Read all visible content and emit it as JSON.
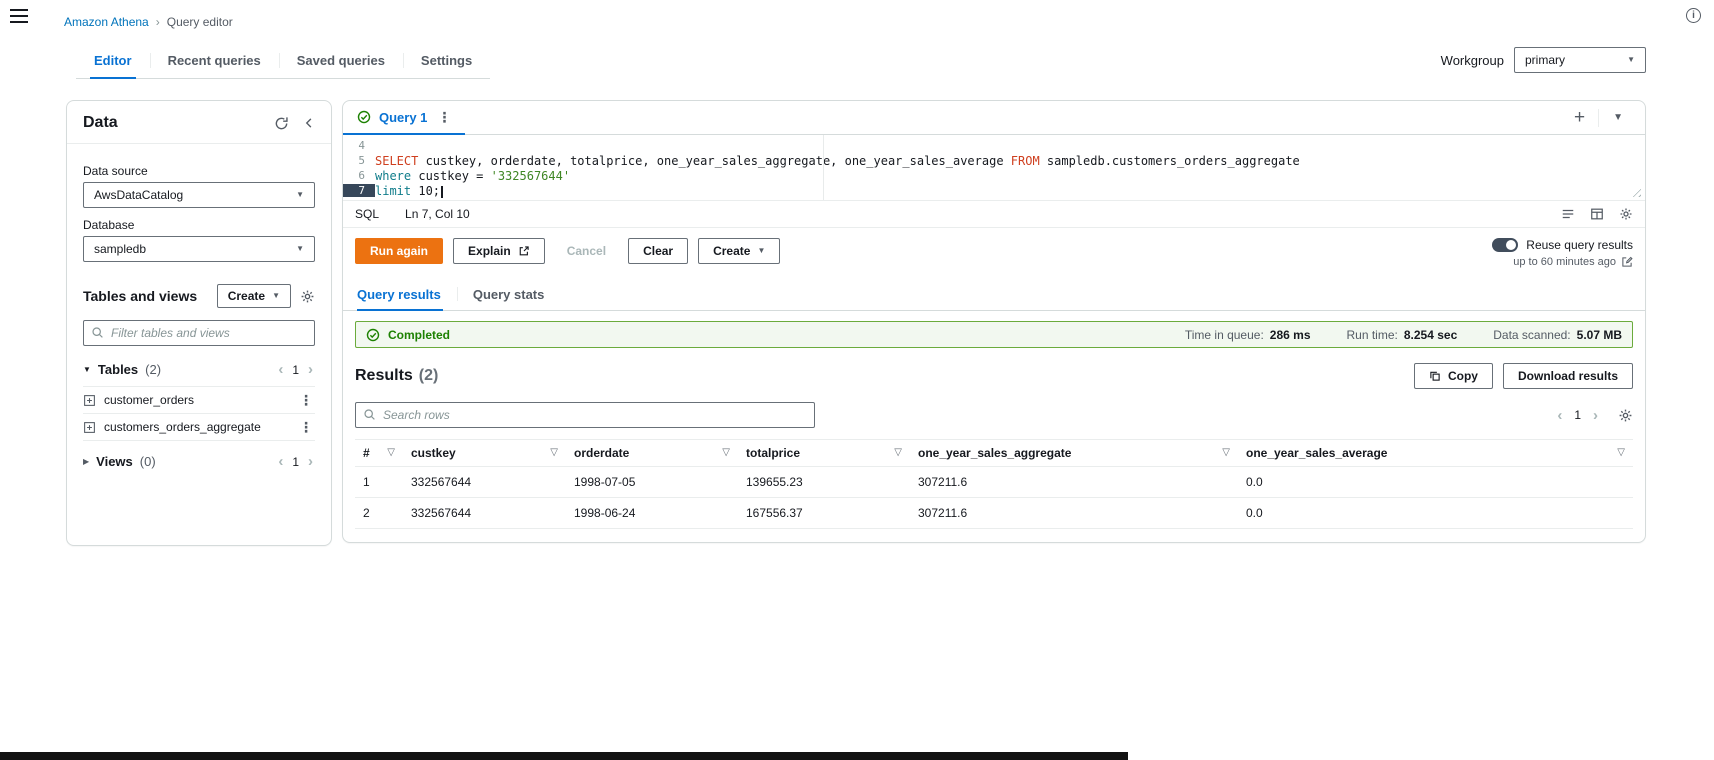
{
  "colors": {
    "accent_orange": "#ec7211",
    "link_blue": "#0073bb",
    "active_tab_blue": "#0972d3",
    "success_green": "#1d8102"
  },
  "icons": {
    "caret_down": "▼",
    "caret_right": "▶",
    "kebab": "⋮",
    "plus": "+",
    "chevron_left": "‹",
    "chevron_right": "›",
    "funnel": "▽",
    "info": "i"
  },
  "breadcrumb": {
    "root": "Amazon Athena",
    "separator": "›",
    "current": "Query editor"
  },
  "top_tabs": {
    "editor": "Editor",
    "recent": "Recent queries",
    "saved": "Saved queries",
    "settings": "Settings"
  },
  "workgroup": {
    "label": "Workgroup",
    "value": "primary"
  },
  "sidebar": {
    "title": "Data",
    "data_source_label": "Data source",
    "data_source_value": "AwsDataCatalog",
    "database_label": "Database",
    "database_value": "sampledb",
    "tables_views_title": "Tables and views",
    "create_button": "Create",
    "filter_placeholder": "Filter tables and views",
    "tables": {
      "label": "Tables",
      "count": "(2)",
      "page": "1",
      "items": [
        {
          "name": "customer_orders"
        },
        {
          "name": "customers_orders_aggregate"
        }
      ]
    },
    "views": {
      "label": "Views",
      "count": "(0)",
      "page": "1"
    }
  },
  "query_tab": {
    "label": "Query 1"
  },
  "editor": {
    "language": "SQL",
    "cursor_position": "Ln 7, Col 10",
    "lines": [
      {
        "num": "4",
        "t1": "",
        "t2": "",
        "t3": "",
        "t4": ""
      },
      {
        "num": "5",
        "t1": "SELECT",
        "t2": " custkey, orderdate, totalprice, one_year_sales_aggregate, one_year_sales_average ",
        "t3": "FROM",
        "t4": " sampledb.customers_orders_aggregate"
      },
      {
        "num": "6",
        "t1": "where",
        "t2": " custkey = ",
        "t3": "'332567644'",
        "t4": ""
      },
      {
        "num": "7",
        "t1": "limit",
        "t2": " 10;",
        "t3": "",
        "t4": ""
      }
    ]
  },
  "actions": {
    "run": "Run again",
    "explain": "Explain",
    "cancel": "Cancel",
    "clear": "Clear",
    "create": "Create",
    "reuse_label": "Reuse query results",
    "reuse_sub": "up to 60 minutes ago"
  },
  "results_tabs": {
    "results": "Query results",
    "stats": "Query stats"
  },
  "banner": {
    "status": "Completed",
    "queue_label": "Time in queue:",
    "queue_value": "286 ms",
    "runtime_label": "Run time:",
    "runtime_value": "8.254 sec",
    "scanned_label": "Data scanned:",
    "scanned_value": "5.07 MB"
  },
  "results": {
    "title": "Results",
    "count": "(2)",
    "copy_button": "Copy",
    "download_button": "Download results",
    "search_placeholder": "Search rows",
    "page": "1",
    "columns": [
      "#",
      "custkey",
      "orderdate",
      "totalprice",
      "one_year_sales_aggregate",
      "one_year_sales_average"
    ],
    "rows": [
      [
        "1",
        "332567644",
        "1998-07-05",
        "139655.23",
        "307211.6",
        "0.0"
      ],
      [
        "2",
        "332567644",
        "1998-06-24",
        "167556.37",
        "307211.6",
        "0.0"
      ]
    ]
  }
}
